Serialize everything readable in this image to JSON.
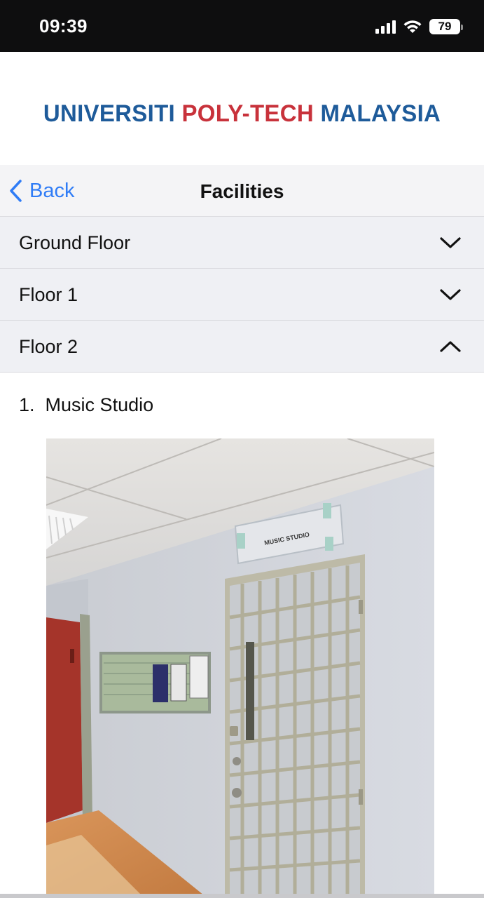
{
  "status_bar": {
    "time": "09:39",
    "battery_level": "79",
    "icons": [
      "signal-icon",
      "wifi-icon",
      "battery-icon"
    ]
  },
  "logo": {
    "word1": "UNIVERSITI",
    "word2": "POLY-TECH",
    "word3": "MALAYSIA",
    "colors": {
      "blue": "#1e5b9a",
      "red": "#c8323b"
    }
  },
  "nav": {
    "back_label": "Back",
    "title": "Facilities",
    "accent": "#2f7cf6"
  },
  "accordion": {
    "items": [
      {
        "label": "Ground Floor",
        "expanded": false
      },
      {
        "label": "Floor 1",
        "expanded": false
      },
      {
        "label": "Floor 2",
        "expanded": true
      }
    ]
  },
  "content": {
    "list_number": "1.",
    "list_label": "Music Studio",
    "photo_sign_text": "MUSIC STUDIO"
  }
}
